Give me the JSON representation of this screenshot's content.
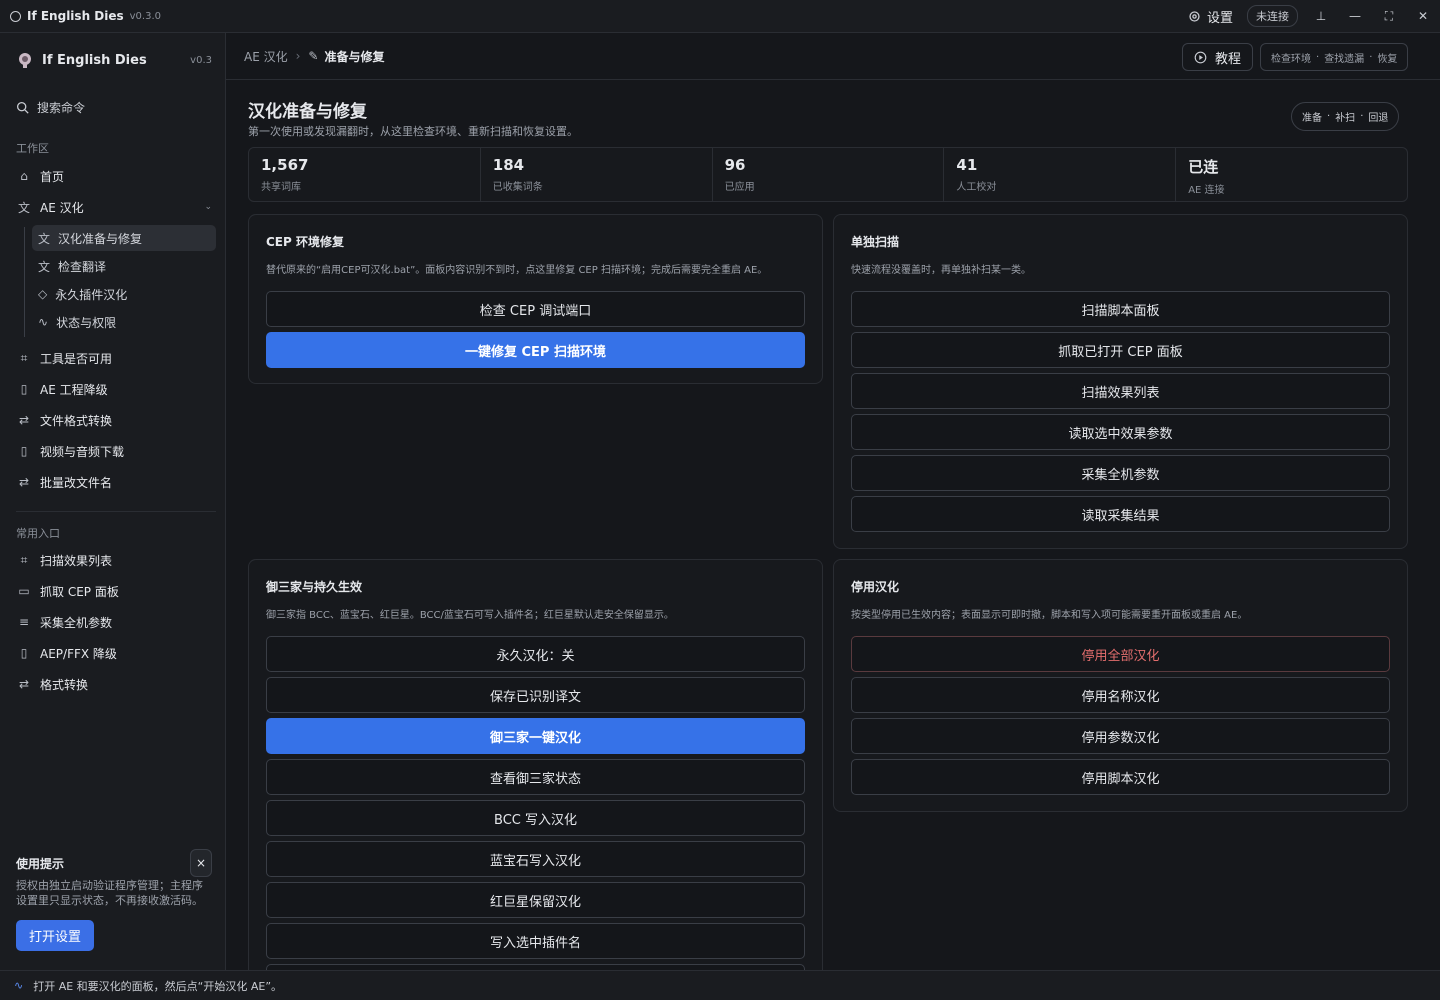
{
  "titlebar": {
    "app_name": "If English Dies",
    "version": "v0.3.0",
    "settings": "设置",
    "connection": "未连接",
    "pin": "⊥",
    "minimize": "—",
    "maximize": "⛶",
    "close": "✕"
  },
  "sidebar": {
    "brand": "If English Dies",
    "brand_version": "v0.3",
    "search": "搜索命令",
    "section_workspace": "工作区",
    "items": [
      "首页",
      "AE 汉化"
    ],
    "sub_items": [
      "汉化准备与修复",
      "检查翻译",
      "永久插件汉化",
      "状态与权限"
    ],
    "tools": [
      "工具是否可用",
      "AE 工程降级",
      "文件格式转换",
      "视频与音频下载",
      "批量改文件名"
    ],
    "section_common": "常用入口",
    "common": [
      "扫描效果列表",
      "抓取 CEP 面板",
      "采集全机参数",
      "AEP/FFX 降级",
      "格式转换"
    ],
    "tip_title": "使用提示",
    "tip_text": "授权由独立启动验证程序管理；主程序设置里只显示状态，不再接收激活码。",
    "tip_button": "打开设置",
    "tip_close": "×"
  },
  "header": {
    "crumb_parent": "AE 汉化",
    "crumb_current": "准备与修复",
    "tutorial": "教程",
    "quick": [
      "检查环境",
      "查找遗漏",
      "恢复"
    ]
  },
  "page": {
    "title": "汉化准备与修复",
    "subtitle": "第一次使用或发现漏翻时，从这里检查环境、重新扫描和恢复设置。",
    "steps": [
      "准备",
      "补扫",
      "回退"
    ]
  },
  "stats": [
    {
      "value": "1,567",
      "label": "共享词库"
    },
    {
      "value": "184",
      "label": "已收集词条"
    },
    {
      "value": "96",
      "label": "已应用"
    },
    {
      "value": "41",
      "label": "人工校对"
    },
    {
      "value": "已连",
      "label": "AE 连接"
    }
  ],
  "cards": {
    "cep": {
      "title": "CEP 环境修复",
      "desc": "替代原来的“启用CEP可汉化.bat”。面板内容识别不到时，点这里修复 CEP 扫描环境；完成后需要完全重启 AE。",
      "buttons": [
        "检查 CEP 调试端口",
        "一键修复 CEP 扫描环境"
      ]
    },
    "scan": {
      "title": "单独扫描",
      "desc": "快速流程没覆盖时，再单独补扫某一类。",
      "buttons": [
        "扫描脚本面板",
        "抓取已打开 CEP 面板",
        "扫描效果列表",
        "读取选中效果参数",
        "采集全机参数",
        "读取采集结果"
      ]
    },
    "plugins": {
      "title": "御三家与持久生效",
      "desc": "御三家指 BCC、蓝宝石、红巨星。BCC/蓝宝石可写入插件名；红巨星默认走安全保留显示。",
      "buttons": [
        "永久汉化：关",
        "保存已识别译文",
        "御三家一键汉化",
        "查看御三家状态",
        "BCC 写入汉化",
        "蓝宝石写入汉化",
        "红巨星保留汉化",
        "写入选中插件名"
      ]
    },
    "disable": {
      "title": "停用汉化",
      "desc": "按类型停用已生效内容；表面显示可即时撤，脚本和写入项可能需要重开面板或重启 AE。",
      "buttons": [
        "停用全部汉化",
        "停用名称汉化",
        "停用参数汉化",
        "停用脚本汉化"
      ]
    }
  },
  "statusbar": {
    "text": "打开 AE 和要汉化的面板，然后点“开始汉化 AE”。"
  },
  "colors": {
    "accent": "#3672e8",
    "danger": "#e26d6d",
    "background": "#15171b"
  }
}
